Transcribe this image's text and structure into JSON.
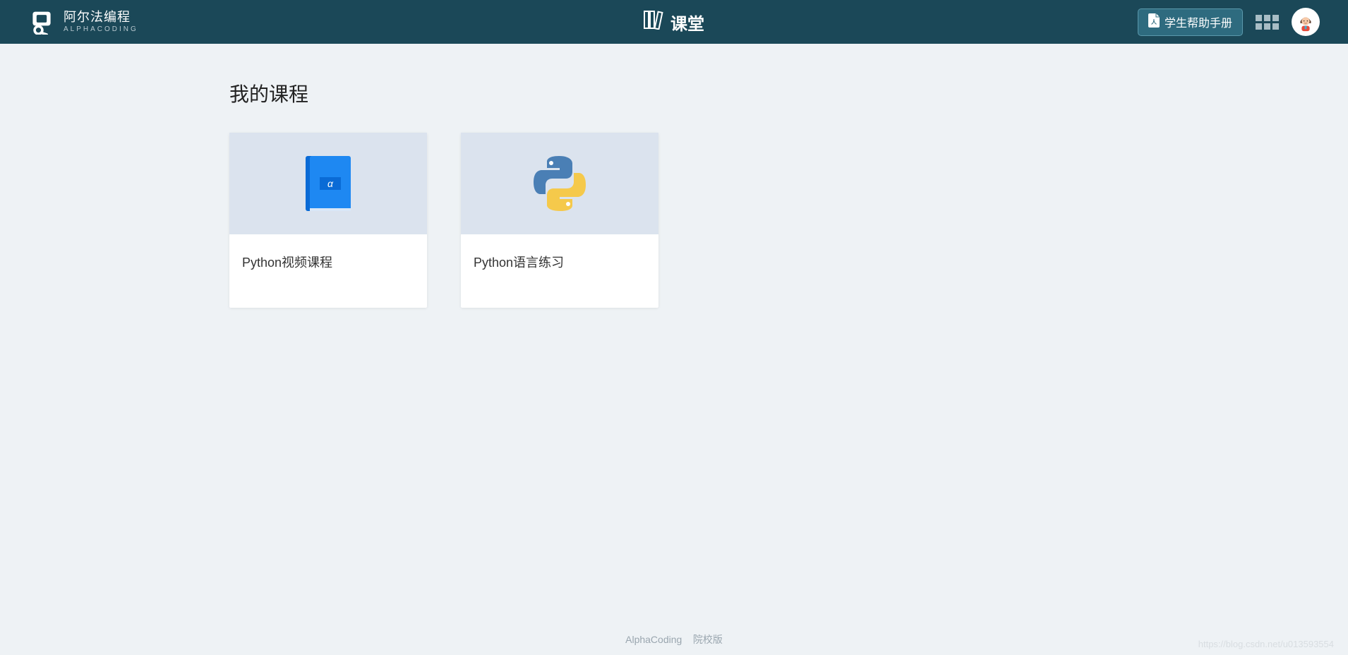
{
  "brand": {
    "cn": "阿尔法编程",
    "en": "ALPHACODING"
  },
  "header": {
    "title": "课堂",
    "help_label": "学生帮助手册"
  },
  "page": {
    "title": "我的课程"
  },
  "cards": [
    {
      "title": "Python视频课程"
    },
    {
      "title": "Python语言练习"
    }
  ],
  "footer": {
    "brand": "AlphaCoding",
    "edition": "院校版"
  },
  "watermark": "https://blog.csdn.net/u013593554"
}
